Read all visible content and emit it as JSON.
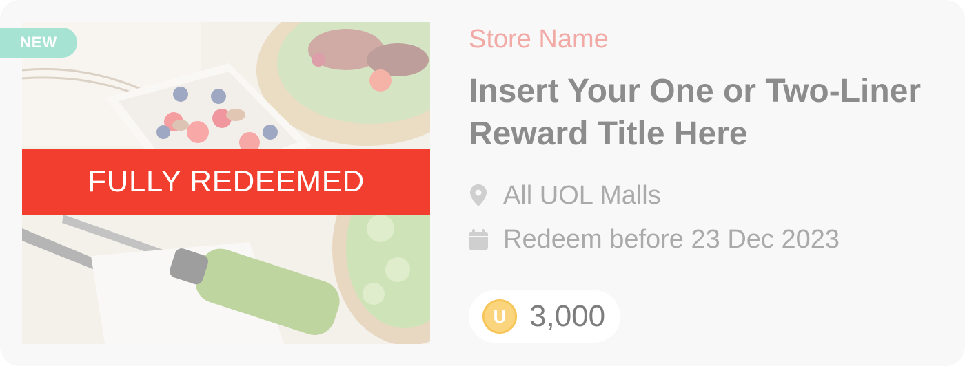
{
  "badge": {
    "label": "NEW"
  },
  "status": {
    "label": "FULLY REDEEMED"
  },
  "reward": {
    "store_name": "Store Name",
    "title": "Insert Your One or Two-Liner Reward Title Here",
    "location": "All UOL Malls",
    "expiry": "Redeem before 23 Dec 2023",
    "points": "3,000",
    "coin_symbol": "U"
  },
  "icons": {
    "location": "map-pin-icon",
    "date": "calendar-icon",
    "coin": "coin-icon"
  },
  "colors": {
    "banner": "#f23e2e",
    "badge": "#a6e3d2",
    "store_name": "#f2aaa6",
    "title": "#8c8c8c",
    "coin": "#fbd57d"
  }
}
